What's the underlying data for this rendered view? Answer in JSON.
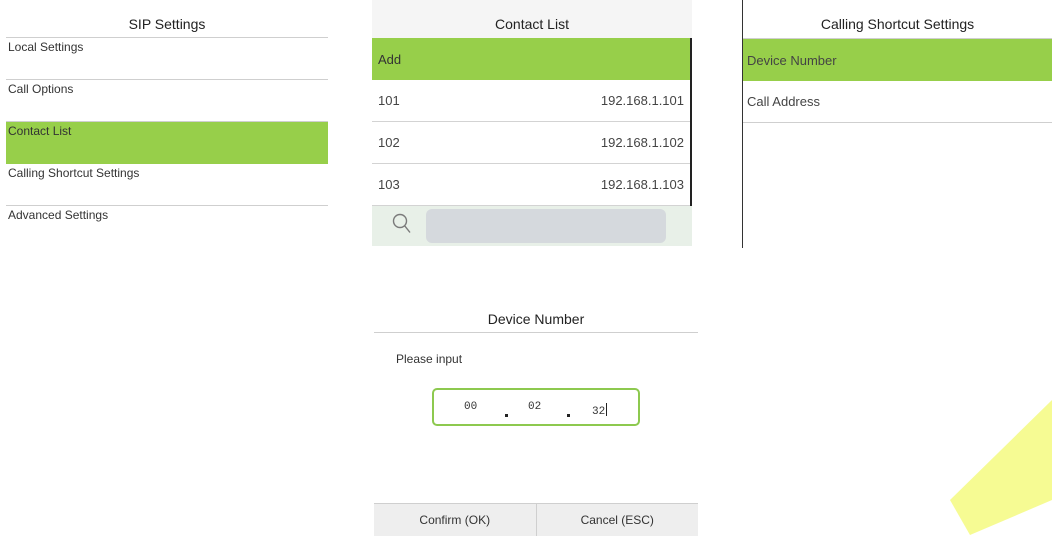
{
  "sip_settings": {
    "title": "SIP Settings",
    "items": [
      {
        "label": "Local Settings"
      },
      {
        "label": "Call Options"
      },
      {
        "label": "Contact List"
      },
      {
        "label": "Calling Shortcut Settings"
      },
      {
        "label": "Advanced Settings"
      }
    ],
    "active_item": "Contact List"
  },
  "contact_list": {
    "title": "Contact List",
    "add_label": "Add",
    "rows": [
      {
        "number": "101",
        "address": "192.168.1.101"
      },
      {
        "number": "102",
        "address": "192.168.1.102"
      },
      {
        "number": "103",
        "address": "192.168.1.103"
      }
    ],
    "search_icon": "search-icon",
    "search_value": ""
  },
  "calling_shortcut": {
    "title": "Calling Shortcut Settings",
    "items": [
      {
        "label": "Device Number"
      },
      {
        "label": "Call Address"
      }
    ],
    "active_item": "Device Number"
  },
  "device_number_dialog": {
    "title": "Device Number",
    "prompt": "Please input",
    "segments": [
      "00",
      "02",
      "32"
    ],
    "confirm_label": "Confirm (OK)",
    "cancel_label": "Cancel (ESC)"
  },
  "colors": {
    "accent": "#97cf4a",
    "input_border": "#8dc94f",
    "search_bar": "#e8f0e8",
    "watermark": "#eef83a"
  }
}
